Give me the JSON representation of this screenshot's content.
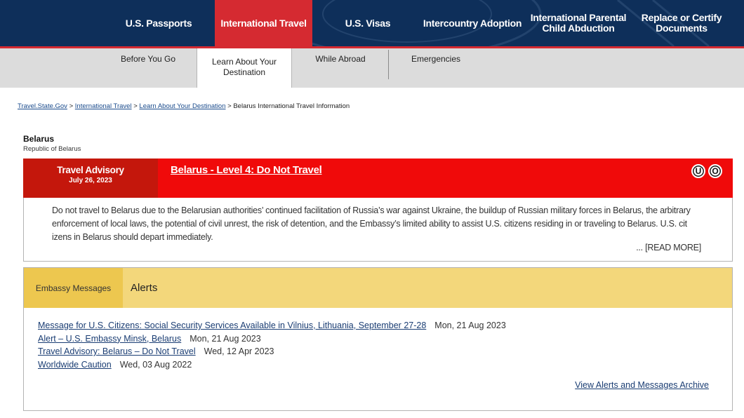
{
  "colors": {
    "nav_bg": "#0e2f5a",
    "accent_red": "#d52a31",
    "advisory_red": "#f00a0a",
    "alert_yellow": "#f3d77b"
  },
  "topnav": {
    "items": [
      {
        "label": "U.S. Passports",
        "active": false
      },
      {
        "label": "International Travel",
        "active": true
      },
      {
        "label": "U.S. Visas",
        "active": false
      },
      {
        "label": "Intercountry Adoption",
        "active": false
      },
      {
        "label": "International Parental Child Abduction",
        "active": false
      },
      {
        "label": "Replace or Certify Documents",
        "active": false
      }
    ]
  },
  "subnav": {
    "items": [
      {
        "label": "Before You Go"
      },
      {
        "label": "Learn About Your Destination",
        "active": true
      },
      {
        "label": "While Abroad"
      },
      {
        "label": "Emergencies"
      }
    ]
  },
  "breadcrumb": {
    "links": [
      "Travel.State.Gov",
      "International Travel",
      "Learn About Your Destination"
    ],
    "separator": ">",
    "current": "Belarus International Travel Information"
  },
  "country": {
    "name": "Belarus",
    "official_name": "Republic of Belarus"
  },
  "advisory": {
    "label": "Travel Advisory",
    "date": "July 26, 2023",
    "title": "Belarus - Level 4: Do Not Travel",
    "icons": [
      {
        "glyph": "U",
        "name": "unrest-icon"
      },
      {
        "glyph": "O",
        "name": "other-icon"
      }
    ],
    "body": "Do not travel to Belarus due to the Belarusian authorities’ continued facilitation of Russia’s war against Ukraine, the buildup of Russian military forces in Belarus, the arbitrary enforcement of local laws, the potential of civil unrest, the risk of detention, and the Embassy’s limited ability to assist U.S. citizens residing in or traveling to Belarus. U.S. cit izens in Belarus should depart immediately.",
    "read_more": "... [READ MORE]"
  },
  "messages": {
    "tab_embassy": "Embassy Messages",
    "tab_alerts": "Alerts",
    "items": [
      {
        "title": "Message for U.S. Citizens: Social Security Services Available in Vilnius, Lithuania, September 27-28",
        "date": "Mon, 21 Aug 2023"
      },
      {
        "title": "Alert – U.S. Embassy Minsk, Belarus",
        "date": "Mon, 21 Aug 2023"
      },
      {
        "title": "Travel Advisory: Belarus – Do Not Travel",
        "date": "Wed, 12 Apr 2023"
      },
      {
        "title": "Worldwide Caution",
        "date": "Wed, 03 Aug 2022"
      }
    ],
    "archive_link": "View Alerts and Messages Archive"
  }
}
